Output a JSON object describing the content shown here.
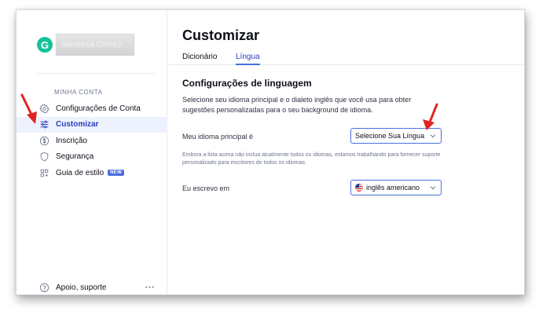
{
  "profile": {
    "logo_letter": "G",
    "name": "Vanessa Cortez"
  },
  "sidebar": {
    "section_heading": "MINHA CONTA",
    "items": [
      {
        "label": "Configurações de Conta",
        "icon": "gear-icon"
      },
      {
        "label": "Customizar",
        "icon": "sliders-icon",
        "active": true
      },
      {
        "label": "Inscrição",
        "icon": "dollar-icon"
      },
      {
        "label": "Segurança",
        "icon": "shield-icon"
      },
      {
        "label": "Guia de estilo",
        "icon": "style-guide-icon",
        "badge": "NEW"
      }
    ],
    "footer": {
      "label": "Apoio, suporte",
      "icon": "help-icon",
      "more": "•••"
    }
  },
  "main": {
    "title": "Customizar",
    "tabs": [
      {
        "label": "Dicionário",
        "active": false
      },
      {
        "label": "Língua",
        "active": true
      }
    ],
    "section_title": "Configurações de linguagem",
    "description": "Selecione seu idioma principal e o dialeto inglês que você usa para obter sugestões personalizadas para o seu background de idioma.",
    "primary_language": {
      "label": "Meu idioma principal é",
      "value": "Selecione Sua Língua"
    },
    "note": "Embora a lista acima não inclua atualmente todos os idiomas, estamos trabalhando para fornecer suporte personalizado para escritores de todos os idiomas.",
    "dialect": {
      "label": "Eu escrevo em",
      "value": "inglês americano",
      "flag": "us-flag-icon"
    }
  },
  "colors": {
    "accent": "#4a6ee0",
    "active_bg": "#eef1fe",
    "brand": "#15c39a",
    "annotation_arrow": "#e32424"
  }
}
